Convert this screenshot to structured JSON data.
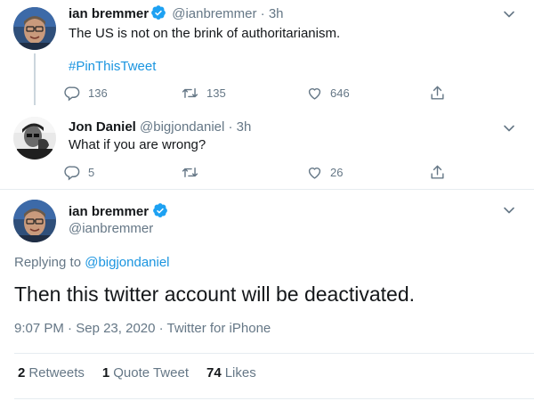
{
  "tweet1": {
    "author_name": "ian bremmer",
    "author_handle": "@ianbremmer",
    "age": "3h",
    "text": "The US is not on the brink of authoritarianism.",
    "hashtag": "#PinThisTweet",
    "reply_count": "136",
    "retweet_count": "135",
    "like_count": "646"
  },
  "tweet2": {
    "author_name": "Jon Daniel",
    "author_handle": "@bigjondaniel",
    "age": "3h",
    "text": "What if you are wrong?",
    "reply_count": "5",
    "retweet_count": "",
    "like_count": "26"
  },
  "main_tweet": {
    "author_name": "ian bremmer",
    "author_handle": "@ianbremmer",
    "replying_prefix": "Replying to",
    "replying_to": "@bigjondaniel",
    "text": "Then this twitter account will be deactivated.",
    "time": "9:07 PM",
    "date": "Sep 23, 2020",
    "source": "Twitter for iPhone",
    "separator": "·",
    "retweets_count": "2",
    "retweets_label": "Retweets",
    "quote_count": "1",
    "quote_label": "Quote Tweet",
    "likes_count": "74",
    "likes_label": "Likes"
  },
  "colors": {
    "verified": "#1da1f2",
    "link": "#1b95e0",
    "secondary_text": "#657786",
    "primary_text": "#14171a"
  },
  "icons": [
    "verified-badge-icon",
    "chevron-down-icon",
    "reply-icon",
    "retweet-icon",
    "like-icon",
    "share-icon"
  ]
}
